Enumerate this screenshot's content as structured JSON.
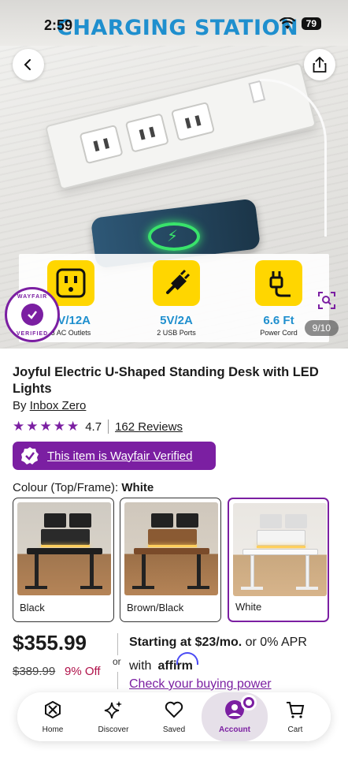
{
  "status_bar": {
    "time": "2:59",
    "battery": "79"
  },
  "hero": {
    "headline": "CHARGING STATION",
    "features": [
      {
        "value": "5V/12A",
        "caption": "3 AC Outlets",
        "icon": "outlet-icon"
      },
      {
        "value": "5V/2A",
        "caption": "2 USB Ports",
        "icon": "usb-plug-icon"
      },
      {
        "value": "6.6 Ft",
        "caption": "Power Cord",
        "icon": "power-cord-icon"
      }
    ],
    "seal_top": "WAYFAIR",
    "seal_bottom": "VERIFIED",
    "image_counter": "9/10"
  },
  "product": {
    "title": "Joyful Electric U-Shaped Standing Desk with LED Lights",
    "by_prefix": "By",
    "brand": "Inbox Zero",
    "rating": "4.7",
    "reviews": "162 Reviews",
    "verified_label": "This item is Wayfair Verified"
  },
  "colour": {
    "label": "Colour (Top/Frame):",
    "selected": "White",
    "options": [
      {
        "name": "Black"
      },
      {
        "name": "Brown/Black"
      },
      {
        "name": "White"
      }
    ]
  },
  "pricing": {
    "price": "$355.99",
    "old_price": "$389.99",
    "discount": "9% Off",
    "or": "or",
    "starting_at": "Starting at",
    "monthly": "$23/mo.",
    "apr": "or 0% APR",
    "with": "with",
    "affirm": "affirm",
    "buying_power": "Check your buying power"
  },
  "nav": {
    "items": [
      {
        "label": "Home",
        "icon": "home-icon"
      },
      {
        "label": "Discover",
        "icon": "sparkle-icon"
      },
      {
        "label": "Saved",
        "icon": "heart-icon"
      },
      {
        "label": "Account",
        "icon": "account-icon"
      },
      {
        "label": "Cart",
        "icon": "cart-icon"
      }
    ],
    "active": "Account"
  },
  "colors": {
    "brand_purple": "#7b1fa2",
    "headline_blue": "#1f8fce",
    "feature_yellow": "#ffd600",
    "discount_red": "#b0124a"
  }
}
